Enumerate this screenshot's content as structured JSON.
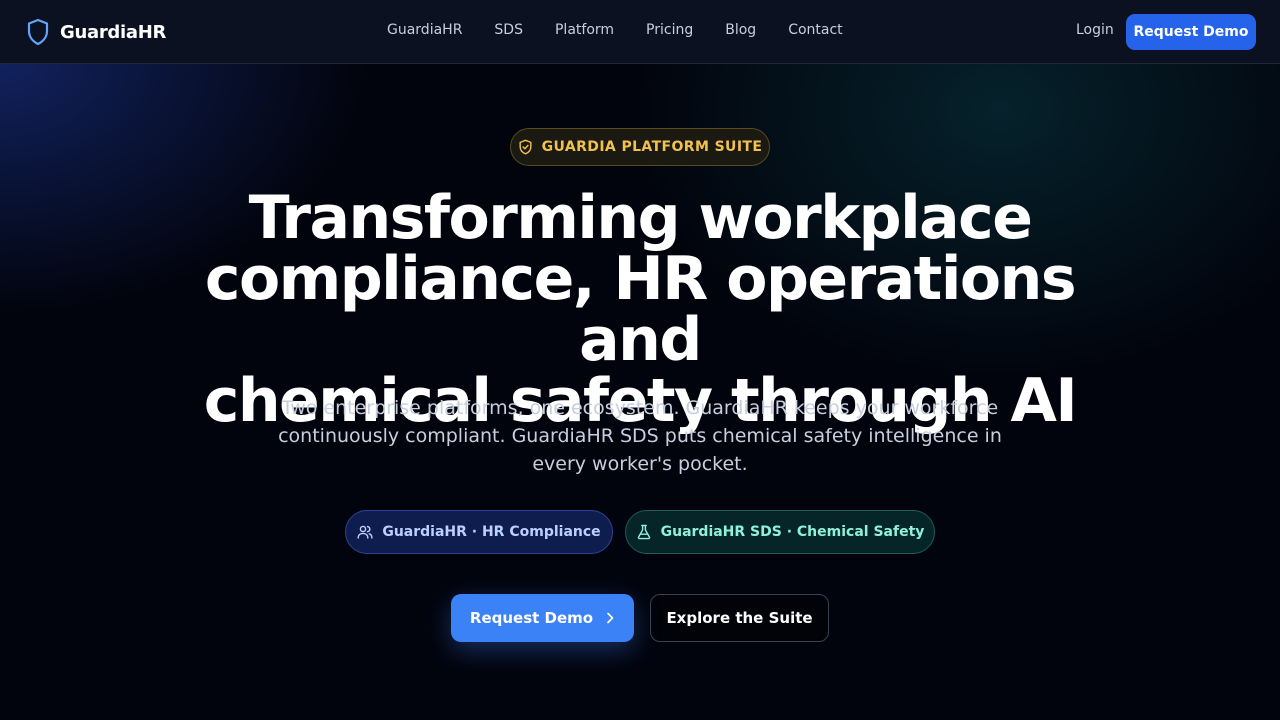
{
  "brand": {
    "name": "GuardiaHR",
    "logo_icon": "shield-icon",
    "accent": "#60a5fa"
  },
  "nav": {
    "items": [
      {
        "label": "GuardiaHR"
      },
      {
        "label": "SDS"
      },
      {
        "label": "Platform"
      },
      {
        "label": "Pricing"
      },
      {
        "label": "Blog"
      },
      {
        "label": "Contact"
      }
    ],
    "login_label": "Login",
    "demo_label": "Request Demo"
  },
  "hero": {
    "badge": {
      "icon": "shield-check-icon",
      "label": "GUARDIA PLATFORM SUITE",
      "color": "#f2c14e"
    },
    "headline_lines": [
      "Transforming workplace",
      "compliance, HR operations and",
      "chemical safety through AI"
    ],
    "subtitle_lines": [
      "Two enterprise platforms, one ecosystem. GuardiaHR keeps your workforce",
      "continuously compliant. GuardiaHR SDS puts chemical safety intelligence in",
      "every worker's pocket."
    ],
    "chips": [
      {
        "icon": "users-icon",
        "label": "GuardiaHR · HR Compliance"
      },
      {
        "icon": "flask-icon",
        "label": "GuardiaHR SDS · Chemical Safety"
      }
    ],
    "cta_primary": {
      "label": "Request Demo",
      "icon": "chevron-right-icon",
      "color": "#3b82f6"
    },
    "cta_secondary": {
      "label": "Explore the Suite"
    }
  }
}
